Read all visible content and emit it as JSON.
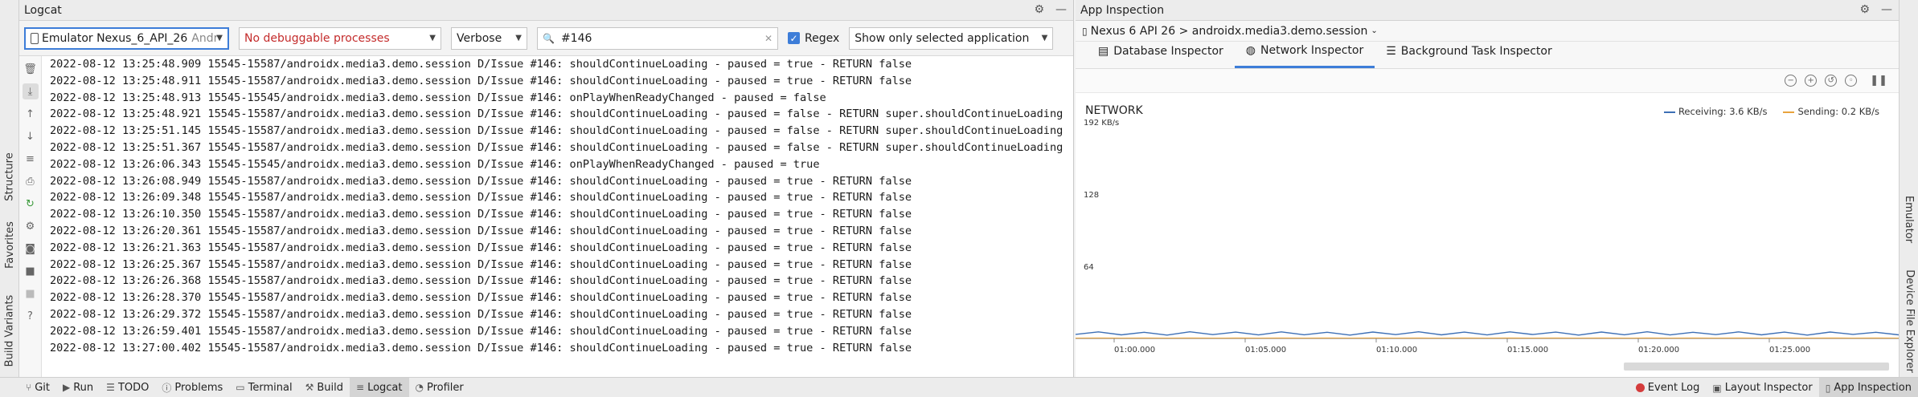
{
  "left_strip": {
    "tabs": [
      "Structure",
      "Favorites",
      "Build Variants"
    ]
  },
  "logcat": {
    "title": "Logcat",
    "device": "Emulator Nexus_6_API_26",
    "device_suffix": "Andr",
    "process": "No debuggable processes",
    "level": "Verbose",
    "search": "#146",
    "regex_label": "Regex",
    "filter": "Show only selected application",
    "lines": [
      "2022-08-12 13:25:48.909 15545-15587/androidx.media3.demo.session D/Issue #146: shouldContinueLoading - paused = true - RETURN false",
      "2022-08-12 13:25:48.911 15545-15587/androidx.media3.demo.session D/Issue #146: shouldContinueLoading - paused = true - RETURN false",
      "2022-08-12 13:25:48.913 15545-15545/androidx.media3.demo.session D/Issue #146: onPlayWhenReadyChanged - paused = false",
      "2022-08-12 13:25:48.921 15545-15587/androidx.media3.demo.session D/Issue #146: shouldContinueLoading - paused = false - RETURN super.shouldContinueLoading",
      "2022-08-12 13:25:51.145 15545-15587/androidx.media3.demo.session D/Issue #146: shouldContinueLoading - paused = false - RETURN super.shouldContinueLoading",
      "2022-08-12 13:25:51.367 15545-15587/androidx.media3.demo.session D/Issue #146: shouldContinueLoading - paused = false - RETURN super.shouldContinueLoading",
      "2022-08-12 13:26:06.343 15545-15545/androidx.media3.demo.session D/Issue #146: onPlayWhenReadyChanged - paused = true",
      "2022-08-12 13:26:08.949 15545-15587/androidx.media3.demo.session D/Issue #146: shouldContinueLoading - paused = true - RETURN false",
      "2022-08-12 13:26:09.348 15545-15587/androidx.media3.demo.session D/Issue #146: shouldContinueLoading - paused = true - RETURN false",
      "2022-08-12 13:26:10.350 15545-15587/androidx.media3.demo.session D/Issue #146: shouldContinueLoading - paused = true - RETURN false",
      "2022-08-12 13:26:20.361 15545-15587/androidx.media3.demo.session D/Issue #146: shouldContinueLoading - paused = true - RETURN false",
      "2022-08-12 13:26:21.363 15545-15587/androidx.media3.demo.session D/Issue #146: shouldContinueLoading - paused = true - RETURN false",
      "2022-08-12 13:26:25.367 15545-15587/androidx.media3.demo.session D/Issue #146: shouldContinueLoading - paused = true - RETURN false",
      "2022-08-12 13:26:26.368 15545-15587/androidx.media3.demo.session D/Issue #146: shouldContinueLoading - paused = true - RETURN false",
      "2022-08-12 13:26:28.370 15545-15587/androidx.media3.demo.session D/Issue #146: shouldContinueLoading - paused = true - RETURN false",
      "2022-08-12 13:26:29.372 15545-15587/androidx.media3.demo.session D/Issue #146: shouldContinueLoading - paused = true - RETURN false",
      "2022-08-12 13:26:59.401 15545-15587/androidx.media3.demo.session D/Issue #146: shouldContinueLoading - paused = true - RETURN false",
      "2022-08-12 13:27:00.402 15545-15587/androidx.media3.demo.session D/Issue #146: shouldContinueLoading - paused = true - RETURN false"
    ]
  },
  "inspection": {
    "title": "App Inspection",
    "process": "Nexus 6 API 26 > androidx.media3.demo.session",
    "tabs": [
      "Database Inspector",
      "Network Inspector",
      "Background Task Inspector"
    ],
    "active_tab": "Network Inspector"
  },
  "chart_data": {
    "type": "line",
    "title": "NETWORK",
    "y_unit_label": "192 KB/s",
    "ylim": [
      0,
      192
    ],
    "yticks": [
      "128",
      "64"
    ],
    "xticks": [
      "01:00.000",
      "01:05.000",
      "01:10.000",
      "01:15.000",
      "01:20.000",
      "01:25.000"
    ],
    "series": [
      {
        "name": "Receiving: 3.6 KB/s",
        "color": "#3d6fb5",
        "values": [
          3.6,
          5.8,
          3.2,
          5.5,
          3.0,
          5.9,
          3.4,
          5.6,
          3.1,
          5.8,
          3.3,
          5.5,
          3.0,
          5.7,
          3.4,
          5.9,
          3.2,
          5.6,
          3.1,
          5.8,
          3.5,
          5.6,
          3.0,
          5.7,
          3.3,
          5.9,
          3.1,
          5.5,
          3.4,
          5.8,
          3.2,
          5.6,
          3.0,
          5.7,
          3.6,
          5.5,
          3.2
        ]
      },
      {
        "name": "Sending: 0.2 KB/s",
        "color": "#e8a33d",
        "values": [
          0.2,
          0.3,
          0.2,
          0.3,
          0.2,
          0.3,
          0.2,
          0.3,
          0.2,
          0.3,
          0.2,
          0.3,
          0.2,
          0.3,
          0.2,
          0.3,
          0.2,
          0.3,
          0.2,
          0.3,
          0.2,
          0.3,
          0.2,
          0.3,
          0.2,
          0.3,
          0.2,
          0.3,
          0.2,
          0.3,
          0.2,
          0.3,
          0.2,
          0.3,
          0.2,
          0.3,
          0.2
        ]
      }
    ]
  },
  "right_strip": {
    "tabs": [
      "Emulator",
      "Device File Explorer"
    ]
  },
  "bottom_bar": {
    "left": [
      "Git",
      "Run",
      "TODO",
      "Problems",
      "Terminal",
      "Build",
      "Logcat",
      "Profiler"
    ],
    "active": "Logcat",
    "right": [
      "Event Log",
      "Layout Inspector",
      "App Inspection"
    ]
  }
}
